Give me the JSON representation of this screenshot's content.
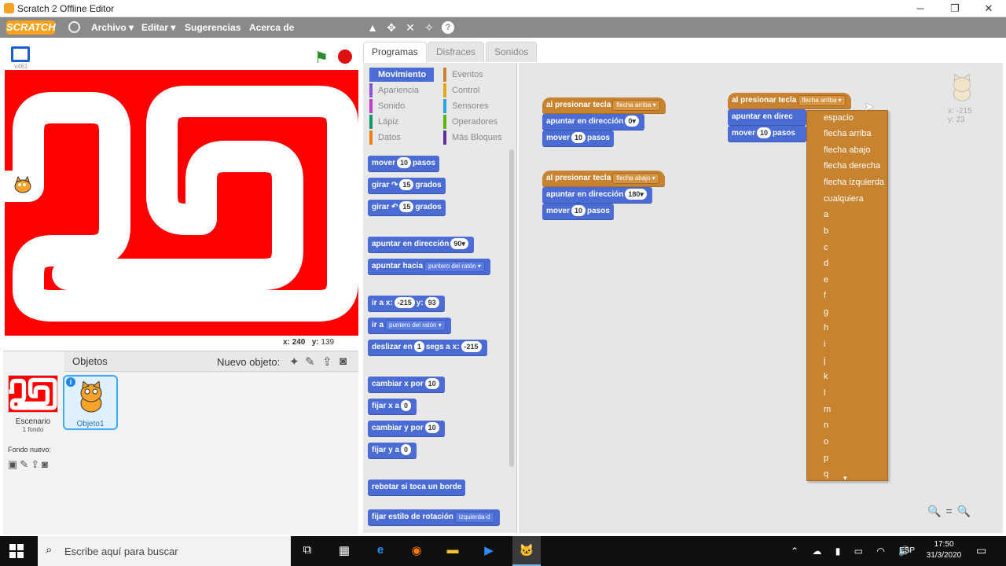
{
  "window": {
    "title": "Scratch 2 Offline Editor",
    "minimize": "─",
    "restore": "❐",
    "close": "✕"
  },
  "menubar": {
    "logo": "SCRATCH",
    "items": [
      "Archivo ▾",
      "Editar ▾",
      "Sugerencias",
      "Acerca de"
    ],
    "tools": [
      "▲",
      "✥",
      "✕",
      "✧",
      "?"
    ]
  },
  "stage": {
    "version": "v461",
    "mouse_x_label": "x:",
    "mouse_x": "240",
    "mouse_y_label": "y:",
    "mouse_y": "139",
    "background_color": "#ff0000"
  },
  "objects": {
    "title": "Objetos",
    "new_object": "Nuevo objeto:",
    "scene_label": "Escenario",
    "scene_count": "1 fondo",
    "new_backdrop": "Fondo nuevo:",
    "sprite_label": "Objeto1",
    "info": "i"
  },
  "tabs": [
    "Programas",
    "Disfraces",
    "Sonidos"
  ],
  "categories": [
    {
      "label": "Movimiento",
      "color": "#4a6cd4"
    },
    {
      "label": "Eventos",
      "color": "#c88330"
    },
    {
      "label": "Apariencia",
      "color": "#8a55d7"
    },
    {
      "label": "Control",
      "color": "#e1a91a"
    },
    {
      "label": "Sonido",
      "color": "#bb42c3"
    },
    {
      "label": "Sensores",
      "color": "#2ca5e2"
    },
    {
      "label": "Lápiz",
      "color": "#0e9a6c"
    },
    {
      "label": "Operadores",
      "color": "#5cb712"
    },
    {
      "label": "Datos",
      "color": "#ee7d16"
    },
    {
      "label": "Más Bloques",
      "color": "#632d99"
    }
  ],
  "palette_blocks": [
    {
      "pre": "mover",
      "v1": "10",
      "post": "pasos"
    },
    {
      "pre": "girar ↷",
      "v1": "15",
      "post": "grados"
    },
    {
      "pre": "girar ↶",
      "v1": "15",
      "post": "grados"
    },
    {
      "pre": "apuntar en dirección",
      "v1": "90▾",
      "post": ""
    },
    {
      "pre": "apuntar hacia",
      "d1": "puntero del ratón ▾",
      "post": ""
    },
    {
      "pre": "ir a x:",
      "v1": "-215",
      "mid": "y:",
      "v2": "93",
      "post": ""
    },
    {
      "pre": "ir a",
      "d1": "puntero del ratón ▾",
      "post": ""
    },
    {
      "pre": "deslizar en",
      "v1": "1",
      "mid": "segs a x:",
      "v2": "-215",
      "post": ""
    },
    {
      "pre": "cambiar x por",
      "v1": "10",
      "post": ""
    },
    {
      "pre": "fijar x a",
      "v1": "0",
      "post": ""
    },
    {
      "pre": "cambiar y por",
      "v1": "10",
      "post": ""
    },
    {
      "pre": "fijar y a",
      "v1": "0",
      "post": ""
    },
    {
      "pre": "rebotar si toca un borde",
      "post": ""
    },
    {
      "pre": "fijar estilo de rotación",
      "d1": "izquierda-d",
      "post": ""
    }
  ],
  "scripts": [
    {
      "hat": "al presionar tecla",
      "key": "flecha arriba ▾",
      "b1_pre": "apuntar en dirección",
      "b1_val": "0▾",
      "b2_pre": "mover",
      "b2_val": "10",
      "b2_post": "pasos"
    },
    {
      "hat": "al presionar tecla",
      "key": "flecha abajo ▾",
      "b1_pre": "apuntar en dirección",
      "b1_val": "180▾",
      "b2_pre": "mover",
      "b2_val": "10",
      "b2_post": "pasos"
    },
    {
      "hat": "al presionar tecla",
      "key": "flecha arriba ▾",
      "b1_pre": "apuntar en direc",
      "b2_pre": "mover",
      "b2_val": "10",
      "b2_post": "pasos"
    }
  ],
  "sprite_info": {
    "x": "x: -215",
    "y": "y: 23"
  },
  "dropdown": {
    "items": [
      "espacio",
      "flecha arriba",
      "flecha abajo",
      "flecha derecha",
      "flecha izquierda",
      "cualquiera",
      "a",
      "b",
      "c",
      "d",
      "e",
      "f",
      "g",
      "h",
      "i",
      "j",
      "k",
      "l",
      "m",
      "n",
      "o",
      "p",
      "q"
    ],
    "more": "▾"
  },
  "zoom": {
    "out": "🔍",
    "reset": "=",
    "in": "🔍"
  },
  "taskbar": {
    "search_placeholder": "Escribe aquí para buscar",
    "language": "ESP",
    "time": "17:50",
    "date": "31/3/2020",
    "apps": [
      "⧉",
      "▦",
      "e",
      "◉",
      "▬",
      "▶",
      "🐱"
    ],
    "tray": "⌃ ☁ ▮ ▭ ◠ 🔊"
  }
}
